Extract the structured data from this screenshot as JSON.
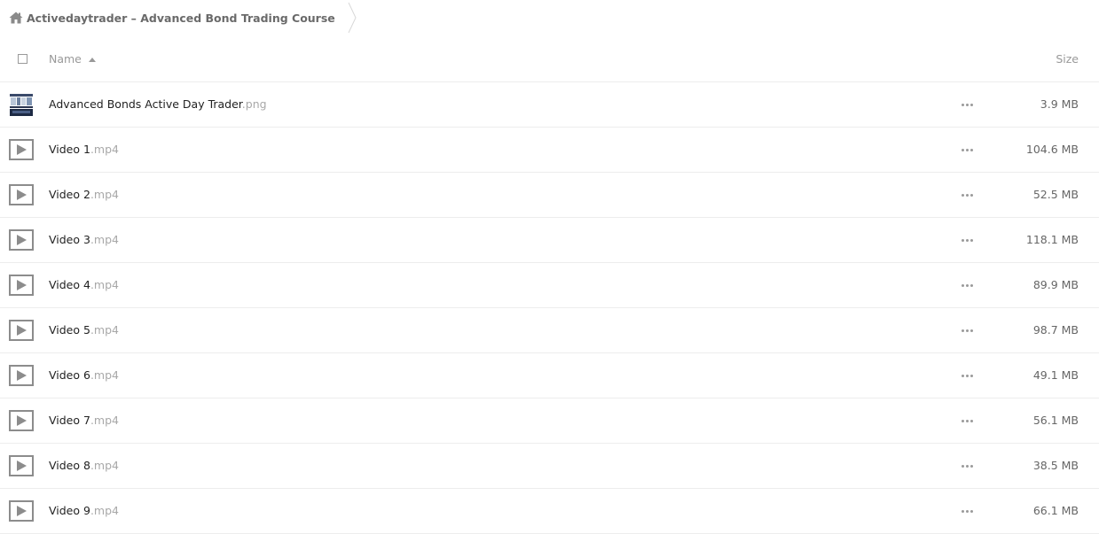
{
  "breadcrumb": {
    "icon": "home-icon",
    "label": "Activedaytrader – Advanced Bond Trading Course"
  },
  "table": {
    "columns": {
      "name": "Name",
      "size": "Size"
    },
    "sort": "ascending",
    "rows": [
      {
        "type": "image",
        "base": "Advanced Bonds Active Day Trader",
        "ext": ".png",
        "size": "3.9 MB"
      },
      {
        "type": "video",
        "base": "Video 1",
        "ext": ".mp4",
        "size": "104.6 MB"
      },
      {
        "type": "video",
        "base": "Video 2",
        "ext": ".mp4",
        "size": "52.5 MB"
      },
      {
        "type": "video",
        "base": "Video 3",
        "ext": ".mp4",
        "size": "118.1 MB"
      },
      {
        "type": "video",
        "base": "Video 4",
        "ext": ".mp4",
        "size": "89.9 MB"
      },
      {
        "type": "video",
        "base": "Video 5",
        "ext": ".mp4",
        "size": "98.7 MB"
      },
      {
        "type": "video",
        "base": "Video 6",
        "ext": ".mp4",
        "size": "49.1 MB"
      },
      {
        "type": "video",
        "base": "Video 7",
        "ext": ".mp4",
        "size": "56.1 MB"
      },
      {
        "type": "video",
        "base": "Video 8",
        "ext": ".mp4",
        "size": "38.5 MB"
      },
      {
        "type": "video",
        "base": "Video 9",
        "ext": ".mp4",
        "size": "66.1 MB"
      }
    ]
  }
}
